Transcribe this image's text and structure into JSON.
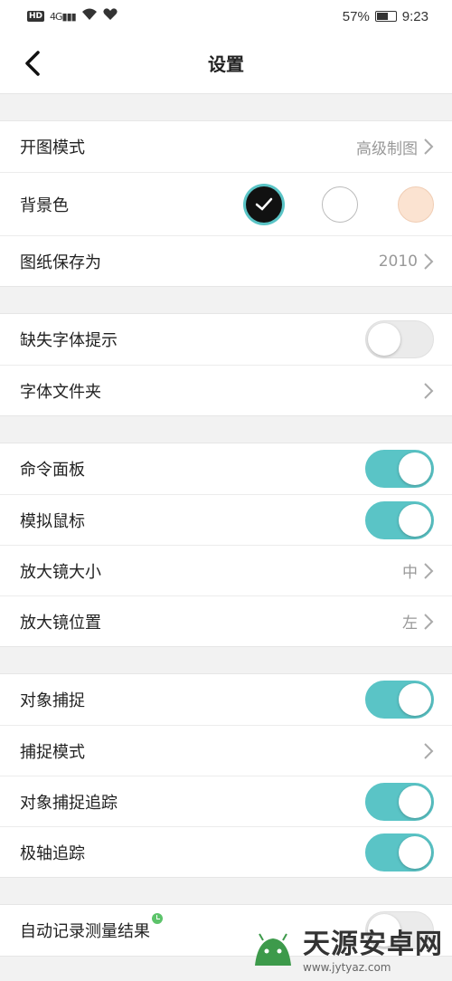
{
  "status_bar": {
    "hd": "HD",
    "network": "4G",
    "battery": "57%",
    "time": "9:23"
  },
  "header": {
    "title": "设置"
  },
  "groups": [
    {
      "rows": [
        {
          "label": "开图模式",
          "value": "高级制图",
          "chevron": true
        },
        {
          "label": "背景色",
          "swatches": [
            "#111111",
            "#ffffff",
            "#fbe3d1"
          ],
          "selected": 0
        },
        {
          "label": "图纸保存为",
          "value": "2010",
          "chevron": true
        }
      ]
    },
    {
      "rows": [
        {
          "label": "缺失字体提示",
          "toggle": false
        },
        {
          "label": "字体文件夹",
          "chevron": true
        }
      ]
    },
    {
      "rows": [
        {
          "label": "命令面板",
          "toggle": true
        },
        {
          "label": "模拟鼠标",
          "toggle": true
        },
        {
          "label": "放大镜大小",
          "value": "中",
          "chevron": true
        },
        {
          "label": "放大镜位置",
          "value": "左",
          "chevron": true
        }
      ]
    },
    {
      "rows": [
        {
          "label": "对象捕捉",
          "toggle": true
        },
        {
          "label": "捕捉模式",
          "chevron": true
        },
        {
          "label": "对象捕捉追踪",
          "toggle": true
        },
        {
          "label": "极轴追踪",
          "toggle": true
        }
      ]
    },
    {
      "rows": [
        {
          "label": "自动记录测量结果",
          "toggle": false,
          "badge": true
        }
      ]
    }
  ],
  "watermark": {
    "name": "天源安卓网",
    "url": "www.jytyaz.com"
  },
  "colors": {
    "accent": "#5ac4c6",
    "toggle_off": "#ebebeb",
    "value_text": "#999999"
  }
}
